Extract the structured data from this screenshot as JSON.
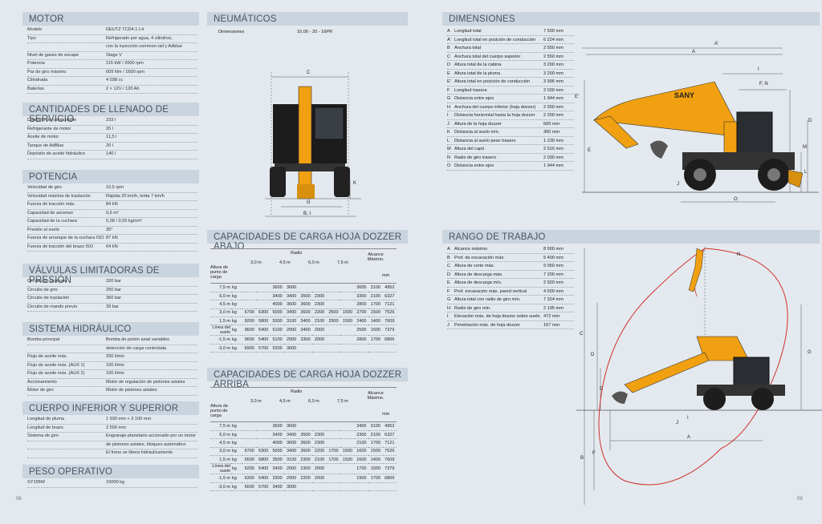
{
  "motor": {
    "title": "MOTOR",
    "rows": [
      [
        "Modelo",
        "DEUTZ TCD4.1 L4"
      ],
      [
        "Tipo",
        "Refrigerado por agua, 4 cilindros,"
      ],
      [
        "",
        "con la inyección common rail y Adblue"
      ],
      [
        "Nivel de gases de escape",
        "Stage V"
      ],
      [
        "Potencia",
        "115 kW / 2000 rpm"
      ],
      [
        "Par de giro máximo",
        "609 Nm / 1600 rpm"
      ],
      [
        "Cilindrada",
        "4 038 cc"
      ],
      [
        "Baterías",
        "2 × 12V / 120 Ah"
      ]
    ]
  },
  "cantidades": {
    "title": "CANTIDADES DE LLENADO DE SERVICIO",
    "rows": [
      [
        "Depósito de combustible",
        "233 l"
      ],
      [
        "Refrigerante de motor",
        "26 l"
      ],
      [
        "Aceite de motor",
        "11,5 l"
      ],
      [
        "Tanque de AdBlue",
        "20 l"
      ],
      [
        "Depósito de aceite hidráulico",
        "140 l"
      ]
    ]
  },
  "potencia": {
    "title": "POTENCIA",
    "rows": [
      [
        "Velocidad de giro",
        "10,5 rpm"
      ],
      [
        "Velocidad máxima de traslación",
        "Rápida 20 km/h, lenta 7 km/h"
      ],
      [
        "Fuerza de tracción máx.",
        "84 kN"
      ],
      [
        "Capacidad de ascenso",
        "0,6 m²"
      ],
      [
        "Capacidad de la cuchara",
        "0,38 / 0,55 kg/cm²"
      ],
      [
        "Presión al suelo",
        "35°"
      ],
      [
        "Fuerza de arranque de la cuchara ISO",
        "87 kN"
      ],
      [
        "Fuerza de tracción del brazo ISO",
        "64 kN"
      ]
    ]
  },
  "valvulas": {
    "title": "VÁLVULAS LIMITADORAS DE PRESIÓN",
    "rows": [
      [
        "Circuito de la pluma",
        "320 bar"
      ],
      [
        "Circuito de giro",
        "250 bar"
      ],
      [
        "Circuito de traslación",
        "360 bar"
      ],
      [
        "Circuito de mando previo",
        "39 bar"
      ]
    ]
  },
  "hidraulico": {
    "title": "SISTEMA HIDRÁULICO",
    "rows": [
      [
        "Bomba principal",
        "Bomba de pistón axial variables"
      ],
      [
        "",
        "detección de carga controlada"
      ],
      [
        "Flujo de aceite máx.",
        "250 l/min"
      ],
      [
        "Flujo de aceite máx. (AUX 1)",
        "100 l/min"
      ],
      [
        "Flujo de aceite máx. (AUX 2)",
        "100 l/min"
      ],
      [
        "Accionamiento",
        "Motor de regulación de pistones axiales"
      ],
      [
        "Motor de giro",
        "Motor de pistones axiales"
      ]
    ]
  },
  "cuerpo": {
    "title": "CUERPO INFERIOR Y SUPERIOR",
    "rows": [
      [
        "Longitud de pluma",
        "1 930 mm + 3 100 mm"
      ],
      [
        "Longitud de brazo",
        "2 500 mm"
      ],
      [
        "Sistema de giro",
        "Engranaje planetario accionado por un motor"
      ],
      [
        "",
        "de pistones axiales, bloqueo automático"
      ],
      [
        "",
        "El freno se libera hidráulicamente"
      ]
    ]
  },
  "peso": {
    "title": "PESO OPERATIVO",
    "rows": [
      [
        "SY155W",
        "15000 kg"
      ]
    ]
  },
  "neumaticos": {
    "title": "NEUMÁTICOS",
    "label": "Dimensiones",
    "value": "10.00 - 20 - 16PR"
  },
  "cap_abajo": {
    "title": "CAPACIDADES DE CARGA HOJA DOZZER ABAJO"
  },
  "cap_arriba": {
    "title": "CAPACIDADES DE CARGA HOJA DOZZER ARRIBA"
  },
  "cap_common": {
    "radio": "Radio",
    "alcance": "Alcance Máximo.",
    "altura": "Altura de punto de carga",
    "cols": [
      "3,0 m",
      "4,5 m",
      "6,0 m",
      "7,5 m"
    ],
    "mm": "mm"
  },
  "cap_rows_abajo": [
    [
      "7,5 m",
      "kg",
      "",
      "",
      "3600",
      "3600",
      "",
      "",
      "",
      "",
      "3005",
      "3100",
      "4952"
    ],
    [
      "6,0 m",
      "kg",
      "",
      "",
      "3400",
      "3400",
      "3500",
      "2300",
      "",
      "",
      "3300",
      "2100",
      "6327"
    ],
    [
      "4,5 m",
      "kg",
      "",
      "",
      "4000",
      "3600",
      "3600",
      "2300",
      "",
      "",
      "2800",
      "1700",
      "7121"
    ],
    [
      "3,0 m",
      "kg",
      "6700",
      "6300",
      "5000",
      "3400",
      "3600",
      "2200",
      "2500",
      "1500",
      "2700",
      "1500",
      "7526"
    ],
    [
      "1,5 m",
      "kg",
      "9200",
      "5800",
      "5300",
      "3100",
      "3400",
      "2100",
      "2500",
      "1500",
      "2400",
      "1400",
      "7609"
    ],
    [
      "Línea del suelo",
      "kg",
      "9600",
      "5400",
      "5100",
      "2900",
      "3400",
      "2000",
      "",
      "",
      "2500",
      "1500",
      "7379"
    ],
    [
      "-1,5 m",
      "kg",
      "9600",
      "5400",
      "5100",
      "2900",
      "3300",
      "2000",
      "",
      "",
      "2800",
      "1700",
      "6806"
    ],
    [
      "-3,0 m",
      "kg",
      "6900",
      "5700",
      "5200",
      "3000",
      "",
      "",
      "",
      "",
      "",
      "",
      ""
    ]
  ],
  "cap_rows_arriba": [
    [
      "7,5 m",
      "kg",
      "",
      "",
      "3600",
      "3600",
      "",
      "",
      "",
      "",
      "3400",
      "3100",
      "4952"
    ],
    [
      "6,0 m",
      "kg",
      "",
      "",
      "3400",
      "3400",
      "3500",
      "2300",
      "",
      "",
      "2300",
      "2100",
      "6327"
    ],
    [
      "4,5 m",
      "kg",
      "",
      "",
      "4000",
      "3600",
      "3600",
      "2300",
      "",
      "",
      "2100",
      "1700",
      "7121"
    ],
    [
      "3,0 m",
      "kg",
      "6700",
      "6300",
      "5000",
      "3400",
      "3600",
      "2200",
      "1700",
      "1500",
      "1600",
      "1500",
      "7526"
    ],
    [
      "1,5 m",
      "kg",
      "6500",
      "5800",
      "3500",
      "3100",
      "2300",
      "2100",
      "1700",
      "1500",
      "1600",
      "1400",
      "7609"
    ],
    [
      "Línea del suelo",
      "kg",
      "6200",
      "5400",
      "3400",
      "2900",
      "2300",
      "2000",
      "",
      "",
      "1700",
      "1500",
      "7379"
    ],
    [
      "-1,5 m",
      "kg",
      "6300",
      "5400",
      "3300",
      "2900",
      "2200",
      "2000",
      "",
      "",
      "1900",
      "1700",
      "6806"
    ],
    [
      "-3,0 m",
      "kg",
      "6600",
      "5700",
      "3400",
      "3000",
      "",
      "",
      "",
      "",
      "",
      "",
      ""
    ]
  ],
  "dimensiones": {
    "title": "DIMENSIONES",
    "rows": [
      [
        "A",
        "Longitud total",
        "7 500 mm"
      ],
      [
        "A'",
        "Longitud total en posición de conducción",
        "6 224 mm"
      ],
      [
        "B",
        "Anchura total",
        "2 550 mm"
      ],
      [
        "C",
        "Anchura total del cuerpo superior",
        "2 550 mm"
      ],
      [
        "D",
        "Altura total de la cabina",
        "3 200 mm"
      ],
      [
        "E",
        "Altura total de la pluma",
        "3 200 mm"
      ],
      [
        "E'",
        "Altura total en posición de conducción",
        "3 996 mm"
      ],
      [
        "F",
        "Longitud trasera",
        "2 030 mm"
      ],
      [
        "G",
        "Distancia entre ejes",
        "1 944 mm"
      ],
      [
        "H",
        "Anchura del cuerpo inferior (hoja dozzer)",
        "2 550 mm"
      ],
      [
        "I",
        "Distancia horizontal hasta la hoja dozzer",
        "2 200 mm"
      ],
      [
        "J",
        "Altura de la hoja dozzer",
        "600 mm"
      ],
      [
        "K",
        "Distancia al suelo mín.",
        "360 mm"
      ],
      [
        "L",
        "Distancia al suelo peso trasero",
        "1 230 mm"
      ],
      [
        "M",
        "Altura del capó",
        "2 616 mm"
      ],
      [
        "N",
        "Radio de giro trasero",
        "2 030 mm"
      ],
      [
        "O",
        "Distancia entre ejes",
        "1 944 mm"
      ]
    ]
  },
  "rango": {
    "title": "RANGO DE TRABAJO",
    "rows": [
      [
        "A",
        "Alcance máximo",
        "8 900 mm"
      ],
      [
        "B",
        "Prof. de excavación máx.",
        "5 400 mm"
      ],
      [
        "C",
        "Altura de corte máx.",
        "9 950 mm"
      ],
      [
        "D",
        "Altura de descarga máx.",
        "7 200 mm"
      ],
      [
        "E",
        "Altura de descarga mín.",
        "2 920 mm"
      ],
      [
        "F",
        "Prof. excavación máx. pared vertical",
        "4 500 mm"
      ],
      [
        "G",
        "Altura total con radio de giro mín.",
        "7 324 mm"
      ],
      [
        "H",
        "Radio de giro mín.",
        "2 195 mm"
      ],
      [
        "I",
        "Elevación máx. de hoja dozzer sobre suelo",
        "472 mm"
      ],
      [
        "J",
        "Penetración máx. de hoja dozzer",
        "167 mm"
      ]
    ]
  },
  "fig_labels": {
    "front": [
      "C",
      "G",
      "B, I",
      "K"
    ],
    "side": [
      "A'",
      "A",
      "I",
      "F, N",
      "E'",
      "D",
      "M",
      "E",
      "J",
      "H",
      "L",
      "O"
    ],
    "range": [
      "N",
      "C",
      "D",
      "G",
      "E",
      "J",
      "I",
      "A",
      "B",
      "F"
    ],
    "brand": "SANY"
  },
  "pages": {
    "left": "08",
    "right": "09"
  },
  "colors": {
    "accent": "#f0a010",
    "header": "#c9d4de",
    "bg": "#e3e9ef",
    "curve": "#d0302a"
  }
}
